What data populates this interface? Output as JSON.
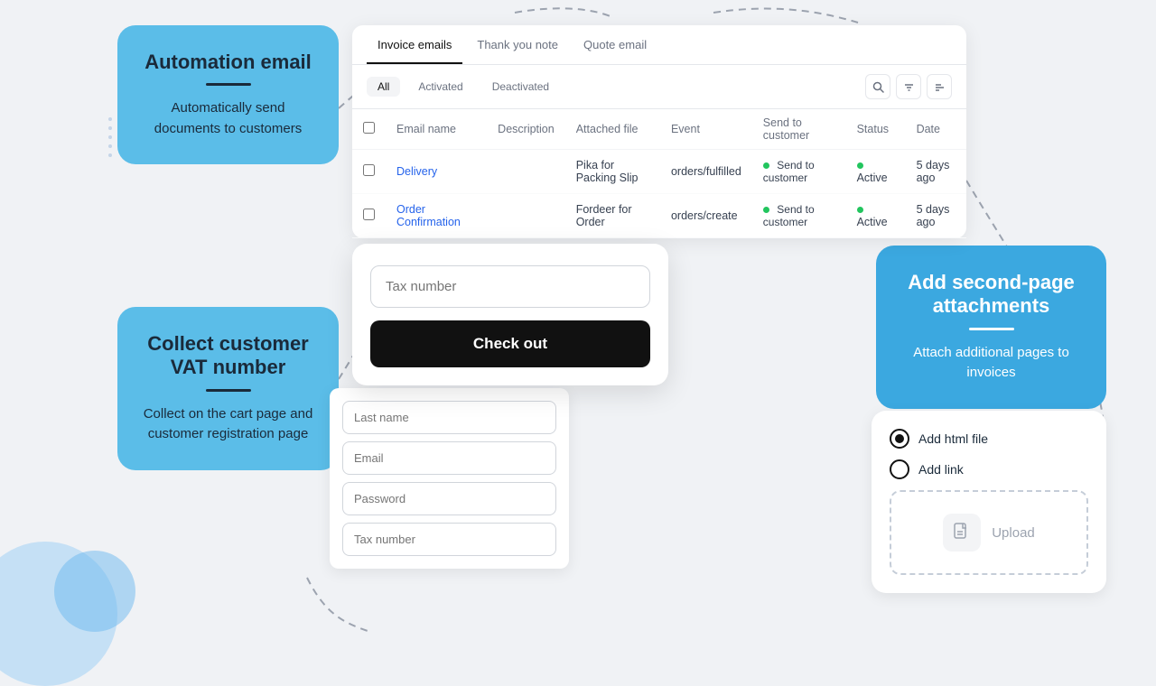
{
  "background": {
    "color": "#f0f2f5"
  },
  "card_automation": {
    "title": "Automation email",
    "description": "Automatically send documents to customers"
  },
  "card_vat": {
    "title": "Collect customer VAT number",
    "description": "Collect on the cart page and customer registration page"
  },
  "card_attachments": {
    "title": "Add second-page attachments",
    "description": "Attach additional pages to invoices"
  },
  "invoice_panel": {
    "tabs": [
      "Invoice emails",
      "Thank you note",
      "Quote email"
    ],
    "active_tab": 0,
    "filters": [
      "All",
      "Activated",
      "Deactivated"
    ],
    "active_filter": 0,
    "table": {
      "columns": [
        "Email name",
        "Description",
        "Attached file",
        "Event",
        "Send to customer",
        "Status",
        "Date"
      ],
      "rows": [
        {
          "name": "Delivery",
          "description": "",
          "attached_file": "Pika for Packing Slip",
          "event": "orders/fulfilled",
          "send_to_customer": "Send to customer",
          "status": "Active",
          "date": "5 days ago"
        },
        {
          "name": "Order Confirmation",
          "description": "",
          "attached_file": "Fordeer for Order",
          "event": "orders/create",
          "send_to_customer": "Send to customer",
          "status": "Active",
          "date": "5 days ago"
        }
      ]
    }
  },
  "checkout_form": {
    "tax_placeholder": "Tax number",
    "checkout_label": "Check out"
  },
  "registration_form": {
    "fields": [
      {
        "placeholder": "Last name"
      },
      {
        "placeholder": "Email"
      },
      {
        "placeholder": "Password"
      },
      {
        "placeholder": "Tax number"
      }
    ]
  },
  "attachments_panel": {
    "radio_options": [
      "Add html file",
      "Add link"
    ],
    "selected_option": 0,
    "upload_label": "Upload"
  }
}
